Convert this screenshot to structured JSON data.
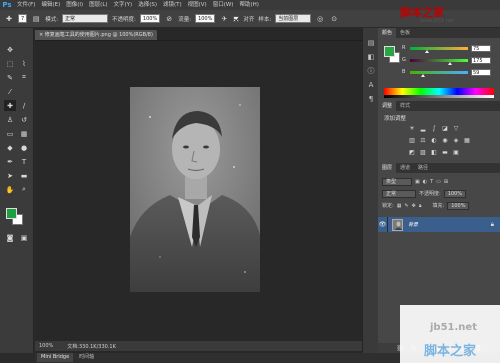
{
  "menubar": {
    "logo": "Ps",
    "items": [
      "文件(F)",
      "编辑(E)",
      "图像(I)",
      "图层(L)",
      "文字(Y)",
      "选择(S)",
      "滤镜(T)",
      "视图(V)",
      "窗口(W)",
      "帮助(H)"
    ]
  },
  "options": {
    "brush_size": "7",
    "mode_label": "模式:",
    "mode_value": "正常",
    "opacity_label": "不透明度:",
    "opacity_value": "100%",
    "flow_label": "流量:",
    "flow_value": "100%",
    "aligned_label": "对齐",
    "sample_label": "样本:",
    "sample_value": "当前图层"
  },
  "document": {
    "tab_title": "× 修复画笔工具的使用图片.png @ 100%(RGB/8)",
    "zoom": "100%",
    "doc_info": "文档:330.1K/330.1K"
  },
  "bottom_tabs": [
    "Mini Bridge",
    "时间轴"
  ],
  "color_panel": {
    "tabs": [
      "颜色",
      "色板"
    ],
    "r_label": "R",
    "g_label": "G",
    "b_label": "B",
    "r_value": "75",
    "g_value": "175",
    "b_value": "59",
    "r_level": 0.29,
    "g_level": 0.69,
    "b_level": 0.23
  },
  "adjust_panel": {
    "tabs": [
      "调整",
      "样式"
    ],
    "title": "添加调整"
  },
  "layers_panel": {
    "tabs": [
      "图层",
      "通道",
      "路径"
    ],
    "kind_label": "类型",
    "blend_mode": "正常",
    "opacity_label": "不透明度:",
    "opacity_value": "100%",
    "lock_label": "锁定:",
    "fill_label": "填充:",
    "fill_value": "100%",
    "layer_name": "背景"
  },
  "watermark": {
    "top_text": "脚本之家",
    "top_url": "www.jb51.net",
    "bottom_url": "jb51.net",
    "bottom_text": "脚本之家"
  },
  "colors": {
    "foreground": "#2aa544",
    "background": "#ffffff",
    "selected_layer": "#3b5f8d"
  }
}
